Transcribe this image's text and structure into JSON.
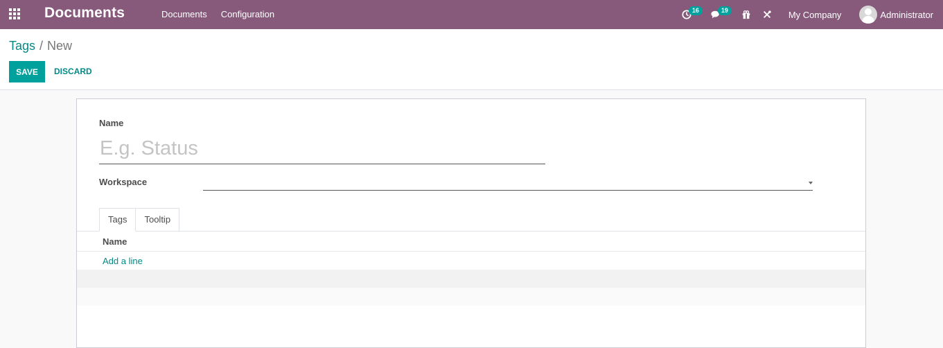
{
  "navbar": {
    "app_title": "Documents",
    "menu": [
      "Documents",
      "Configuration"
    ],
    "activity_count": "16",
    "messages_count": "19",
    "company": "My Company",
    "user": "Administrator",
    "bg_color": "#875a7b",
    "badge_color": "#00a09d"
  },
  "breadcrumb": {
    "parent": "Tags",
    "separator": "/",
    "current": "New"
  },
  "buttons": {
    "save": "SAVE",
    "discard": "DISCARD"
  },
  "form": {
    "name_label": "Name",
    "name_placeholder": "E.g. Status",
    "name_value": "",
    "workspace_label": "Workspace",
    "workspace_value": ""
  },
  "tabs": [
    "Tags",
    "Tooltip"
  ],
  "active_tab": "Tags",
  "tags_table": {
    "column": "Name",
    "add_line": "Add a line"
  },
  "icons": [
    "apps-grid-icon",
    "clock-icon",
    "chat-icon",
    "gift-icon",
    "tools-icon",
    "avatar",
    "dropdown-caret-icon"
  ]
}
